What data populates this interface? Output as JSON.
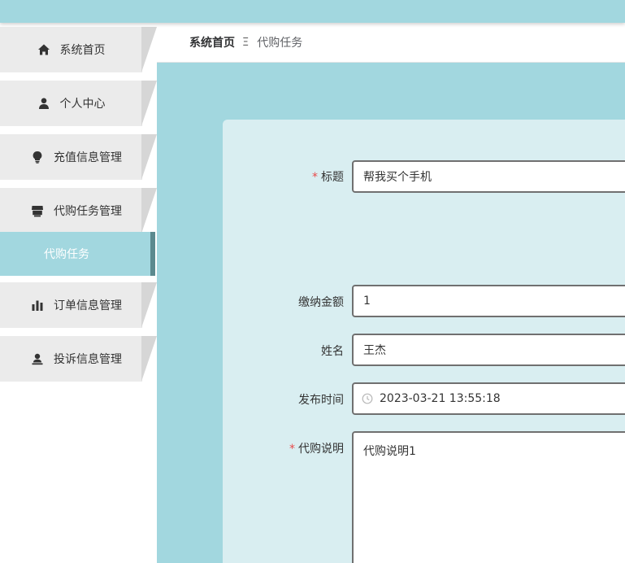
{
  "sidebar": {
    "items": [
      {
        "label": "系统首页",
        "icon": "home-icon"
      },
      {
        "label": "个人中心",
        "icon": "user-icon"
      },
      {
        "label": "充值信息管理",
        "icon": "lightbulb-icon"
      },
      {
        "label": "代购任务管理",
        "icon": "store-icon"
      },
      {
        "label": "订单信息管理",
        "icon": "bar-chart-icon"
      },
      {
        "label": "投诉信息管理",
        "icon": "user-stamp-icon"
      }
    ],
    "active_sub": {
      "label": "代购任务"
    }
  },
  "breadcrumb": {
    "home": "系统首页",
    "separator": "Ξ",
    "current": "代购任务"
  },
  "form": {
    "title": {
      "label": "标题",
      "required": "*",
      "value": "帮我买个手机"
    },
    "amount": {
      "label": "缴纳金额",
      "value": "1"
    },
    "name": {
      "label": "姓名",
      "value": "王杰"
    },
    "publish_time": {
      "label": "发布时间",
      "value": "2023-03-21 13:55:18"
    },
    "description": {
      "label": "代购说明",
      "required": "*",
      "value": "代购说明1"
    }
  },
  "colors": {
    "accent": "#a2d7df",
    "card": "#d9eef1",
    "active_border": "#5c8a8f",
    "required": "#e84a4a"
  }
}
